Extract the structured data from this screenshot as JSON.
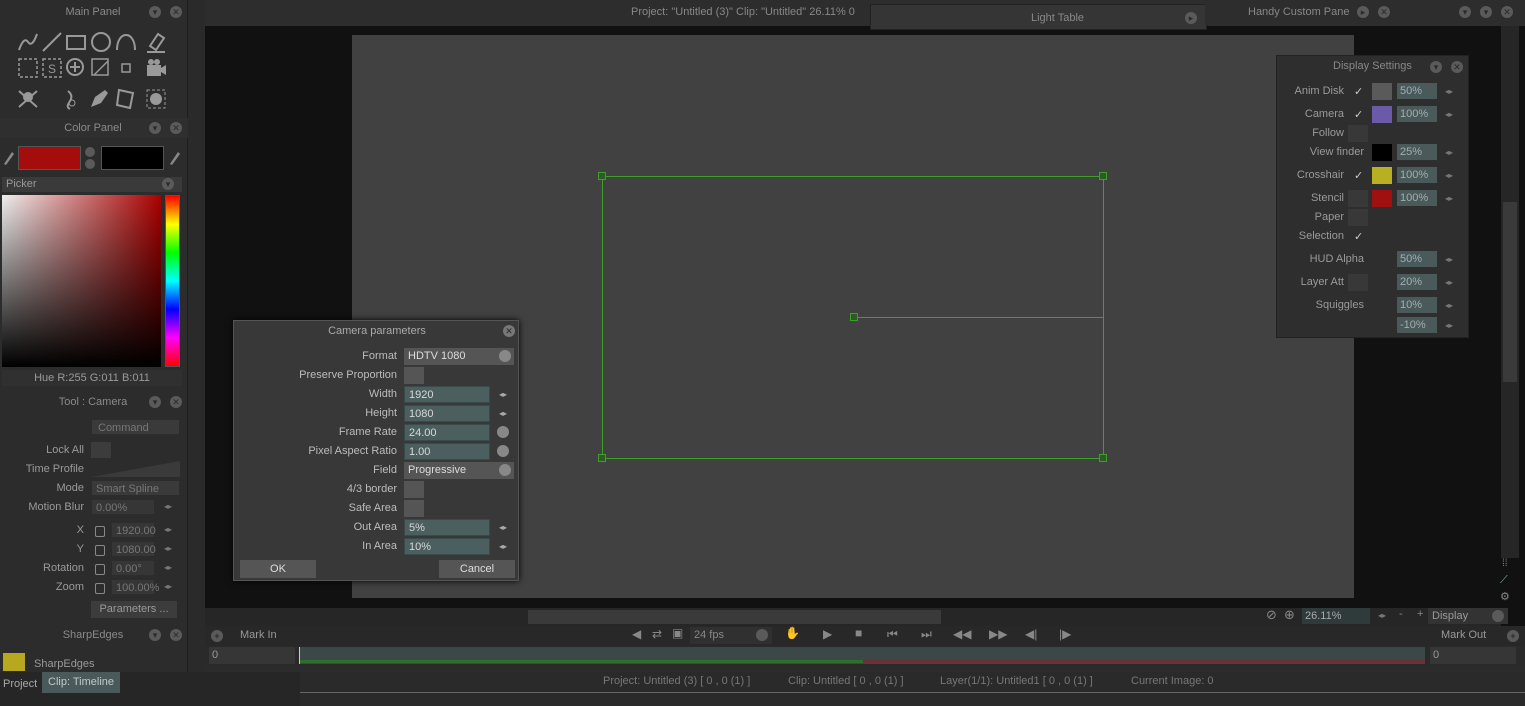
{
  "main_panel": {
    "title": "Main Panel"
  },
  "color_panel": {
    "title": "Color Panel",
    "picker_label": "Picker",
    "hue_readout": "Hue R:255 G:011 B:011",
    "primary_color": "#a50d0d",
    "secondary_color": "#000000"
  },
  "tool_panel": {
    "title": "Tool : Camera",
    "command_label": "Command",
    "lock_all_label": "Lock All",
    "time_profile_label": "Time Profile",
    "mode_label": "Mode",
    "mode_value": "Smart Spline",
    "motion_blur_label": "Motion Blur",
    "motion_blur_value": "0.00%",
    "x_label": "X",
    "x_value": "1920.00",
    "y_label": "Y",
    "y_value": "1080.00",
    "rotation_label": "Rotation",
    "rotation_value": "0.00°",
    "zoom_label": "Zoom",
    "zoom_value": "100.00%",
    "parameters_button": "Parameters ..."
  },
  "sharpedges_panel": {
    "title": "SharpEdges",
    "item": "SharpEdges"
  },
  "bottom_tabs": {
    "project": "Project",
    "clip": "Clip: Timeline"
  },
  "viewer": {
    "title": "Project: \"Untitled (3)\" Clip: \"Untitled\" 26.11% 0",
    "light_table": "Light Table",
    "handy_panel": "Handy Custom Pane"
  },
  "display_settings": {
    "title": "Display Settings",
    "rows": {
      "anim_disk": {
        "label": "Anim Disk",
        "value": "50%",
        "checked": "✓"
      },
      "camera": {
        "label": "Camera",
        "value": "100%",
        "checked": "✓"
      },
      "follow": {
        "label": "Follow"
      },
      "view_finder": {
        "label": "View finder",
        "value": "25%"
      },
      "crosshair": {
        "label": "Crosshair",
        "value": "100%",
        "checked": "✓"
      },
      "stencil": {
        "label": "Stencil",
        "value": "100%"
      },
      "paper": {
        "label": "Paper"
      },
      "selection": {
        "label": "Selection",
        "checked": "✓"
      },
      "hud_alpha": {
        "label": "HUD Alpha",
        "value": "50%"
      },
      "layer_att": {
        "label": "Layer Att",
        "value": "20%"
      },
      "squiggles": {
        "label": "Squiggles",
        "value": "10%",
        "value2": "-10%"
      }
    },
    "colors": {
      "anim_disk": "#5a5a5a",
      "camera": "#6a5aa8",
      "view_finder": "#000000",
      "crosshair": "#b8b020",
      "stencil": "#a01010"
    }
  },
  "camera_dialog": {
    "title": "Camera parameters",
    "format_label": "Format",
    "format_value": "HDTV 1080",
    "preserve_label": "Preserve Proportion",
    "width_label": "Width",
    "width_value": "1920",
    "height_label": "Height",
    "height_value": "1080",
    "frame_rate_label": "Frame Rate",
    "frame_rate_value": "24.00",
    "par_label": "Pixel Aspect Ratio",
    "par_value": "1.00",
    "field_label": "Field",
    "field_value": "Progressive",
    "border_label": "4/3 border",
    "safe_area_label": "Safe Area",
    "out_area_label": "Out Area",
    "out_area_value": "5%",
    "in_area_label": "In Area",
    "in_area_value": "10%",
    "ok": "OK",
    "cancel": "Cancel"
  },
  "transport": {
    "zoom_value": "26.11%",
    "display_label": "Display",
    "mark_in": "Mark In",
    "mark_out": "Mark Out",
    "fps": "24 fps",
    "frame_start": "0",
    "frame_end": "0"
  },
  "status_bar": {
    "project": "Project: Untitled (3) [ 0 , 0 (1) ]",
    "clip": "Clip: Untitled [ 0 , 0 (1) ]",
    "layer": "Layer(1/1): Untitled1 [ 0 , 0 (1) ]",
    "current_image": "Current Image: 0"
  },
  "accent": {
    "camera_frame": "#3ea02a"
  }
}
